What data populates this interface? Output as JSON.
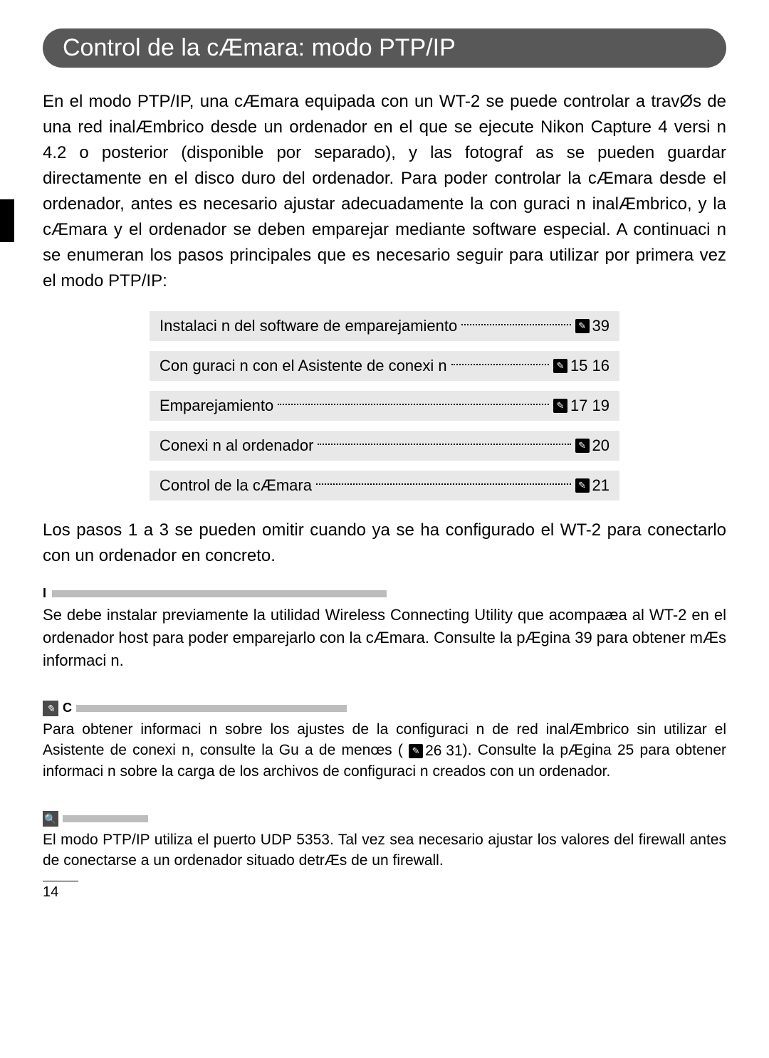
{
  "title": "Control de la cÆmara: modo PTP/IP",
  "intro": "En el modo PTP/IP, una cÆmara equipada con un WT-2 se puede controlar a travØs de una red inalÆmbrico desde un ordenador en el que se ejecute Nikon Capture 4 versi n 4.2 o posterior (disponible por separado), y las fotograf as se pueden guardar directamente en el disco duro del ordenador. Para poder controlar la cÆmara desde el ordenador, antes es necesario ajustar adecuadamente la con guraci n inalÆmbrico, y la cÆmara y el ordenador se deben emparejar mediante software especial. A continuaci n se enumeran los pasos principales que es necesario seguir para utilizar por primera vez el modo PTP/IP:",
  "steps": [
    {
      "label": "Instalaci n del software de emparejamiento",
      "pages": "39"
    },
    {
      "label": "Con guraci n con el Asistente de conexi n",
      "pages": "15 16"
    },
    {
      "label": "Emparejamiento",
      "pages": "17 19"
    },
    {
      "label": "Conexi n al ordenador",
      "pages": "20"
    },
    {
      "label": "Control de la cÆmara",
      "pages": "21"
    }
  ],
  "after_steps": "Los pasos 1 a 3 se pueden omitir cuando ya se ha conﬁgurado el WT-2 para conectarlo con un ordenador en concreto.",
  "note1_label": "I",
  "note1_body": "Se debe instalar previamente la utilidad Wireless Connecting Utility que acompaæa al WT-2 en el ordenador host para poder emparejarlo con la cÆmara. Consulte la pÆgina 39 para obtener mÆs informaci n.",
  "note2_label": "C",
  "note2_body_a": "Para obtener informaci n sobre los ajustes de la conﬁguraci n de red inalÆmbrico sin utilizar el Asistente de conexi n, consulte la Gu a de menœs (",
  "note2_ref": "26 31",
  "note2_body_b": "). Consulte la pÆgina 25 para obtener informaci n sobre la carga de los archivos de conﬁguraci n creados con un ordenador.",
  "note3_body": "El modo PTP/IP utiliza el puerto UDP 5353. Tal vez sea necesario ajustar los valores del ﬁrewall antes de conectarse a un ordenador situado detrÆs de un ﬁrewall.",
  "page_number": "14"
}
